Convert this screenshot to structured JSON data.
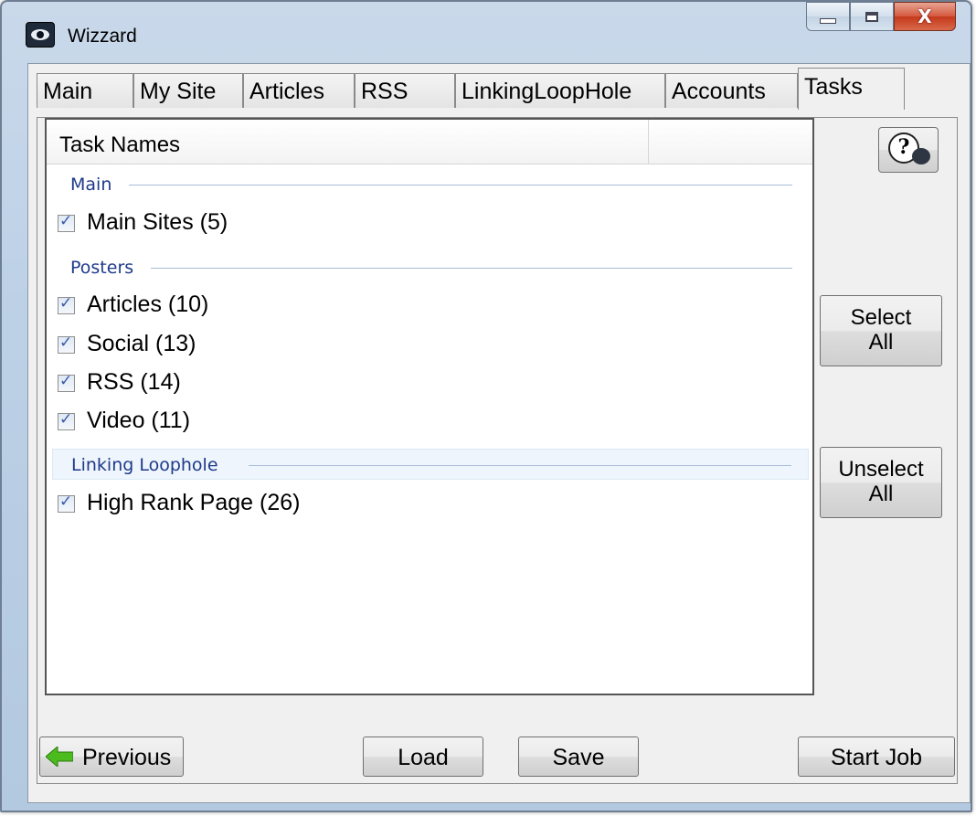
{
  "window": {
    "title": "Wizzard",
    "controls": {
      "minimize": "minimize",
      "maximize": "maximize",
      "close": "X"
    }
  },
  "tabs": [
    {
      "label": "Main",
      "active": false
    },
    {
      "label": "My Site",
      "active": false
    },
    {
      "label": "Articles",
      "active": false
    },
    {
      "label": "RSS",
      "active": false
    },
    {
      "label": "LinkingLoopHole",
      "active": false
    },
    {
      "label": "Accounts",
      "active": false
    },
    {
      "label": "Tasks",
      "active": true
    }
  ],
  "task_list": {
    "column_header": "Task Names",
    "groups": [
      {
        "name": "Main",
        "items": [
          {
            "label": "Main Sites (5)",
            "checked": true
          }
        ]
      },
      {
        "name": "Posters",
        "items": [
          {
            "label": "Articles (10)",
            "checked": true
          },
          {
            "label": "Social (13)",
            "checked": true
          },
          {
            "label": "RSS (14)",
            "checked": true
          },
          {
            "label": "Video (11)",
            "checked": true
          }
        ]
      },
      {
        "name": "Linking Loophole",
        "items": [
          {
            "label": "High Rank Page (26)",
            "checked": true
          }
        ]
      }
    ]
  },
  "side_buttons": {
    "help_icon": "help-icon",
    "select_all_line1": "Select",
    "select_all_line2": "All",
    "unselect_all_line1": "Unselect",
    "unselect_all_line2": "All"
  },
  "footer": {
    "previous": "Previous",
    "load": "Load",
    "save": "Save",
    "start_job": "Start Job"
  },
  "colors": {
    "group_header_text": "#1e3a8a",
    "close_button": "#c4381a",
    "back_arrow": "#4cbb1e"
  }
}
